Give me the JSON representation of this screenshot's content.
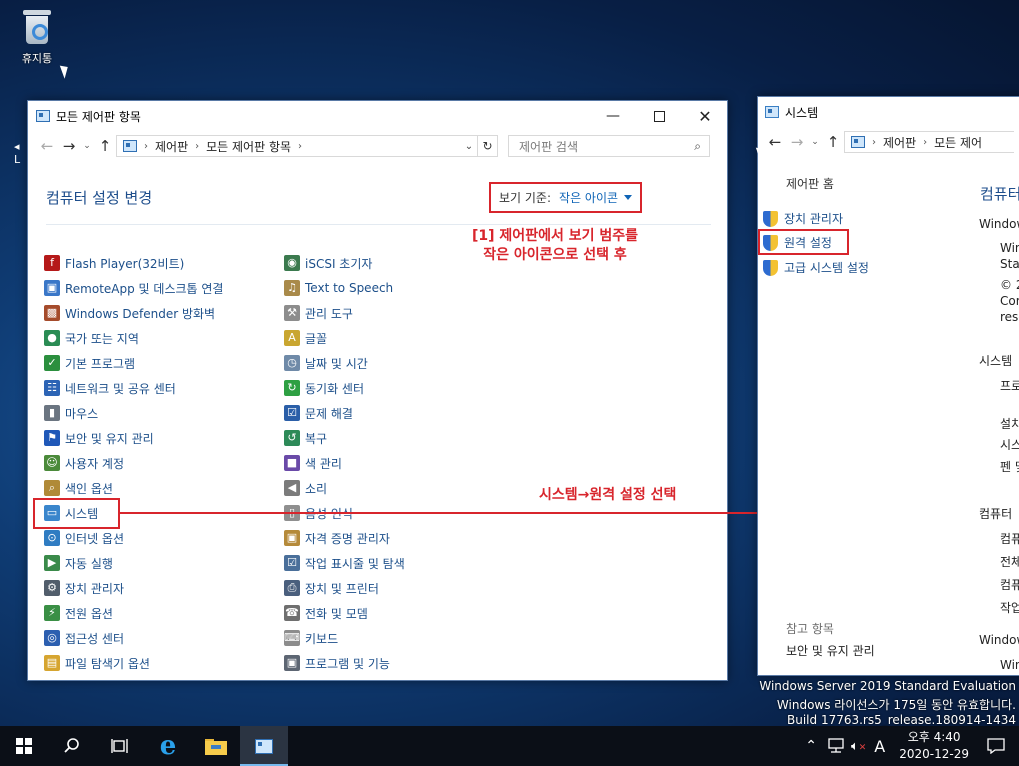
{
  "desktop": {
    "recycle_bin_label": "휴지통"
  },
  "control_panel": {
    "title": "모든 제어판 항목",
    "breadcrumb": [
      "제어판",
      "모든 제어판 항목"
    ],
    "search_placeholder": "제어판 검색",
    "heading": "컴퓨터 설정 변경",
    "view_by_label": "보기 기준:",
    "view_by_value": "작은 아이콘",
    "left_items": [
      {
        "label": "Flash Player(32비트)",
        "icon": "flash-icon"
      },
      {
        "label": "RemoteApp 및 데스크톱 연결",
        "icon": "remoteapp-icon"
      },
      {
        "label": "Windows Defender 방화벽",
        "icon": "firewall-icon"
      },
      {
        "label": "국가 또는 지역",
        "icon": "region-icon"
      },
      {
        "label": "기본 프로그램",
        "icon": "default-programs-icon"
      },
      {
        "label": "네트워크 및 공유 센터",
        "icon": "network-icon"
      },
      {
        "label": "마우스",
        "icon": "mouse-icon"
      },
      {
        "label": "보안 및 유지 관리",
        "icon": "flag-icon"
      },
      {
        "label": "사용자 계정",
        "icon": "users-icon"
      },
      {
        "label": "색인 옵션",
        "icon": "indexing-icon"
      },
      {
        "label": "시스템",
        "icon": "system-icon"
      },
      {
        "label": "인터넷 옵션",
        "icon": "internet-icon"
      },
      {
        "label": "자동 실행",
        "icon": "autoplay-icon"
      },
      {
        "label": "장치 관리자",
        "icon": "device-manager-icon"
      },
      {
        "label": "전원 옵션",
        "icon": "power-icon"
      },
      {
        "label": "접근성 센터",
        "icon": "accessibility-icon"
      },
      {
        "label": "파일 탐색기 옵션",
        "icon": "folder-options-icon"
      }
    ],
    "right_items": [
      {
        "label": "iSCSI 초기자",
        "icon": "iscsi-icon"
      },
      {
        "label": "Text to Speech",
        "icon": "speech-icon"
      },
      {
        "label": "관리 도구",
        "icon": "admin-tools-icon"
      },
      {
        "label": "글꼴",
        "icon": "fonts-icon"
      },
      {
        "label": "날짜 및 시간",
        "icon": "clock-icon"
      },
      {
        "label": "동기화 센터",
        "icon": "sync-icon"
      },
      {
        "label": "문제 해결",
        "icon": "troubleshoot-icon"
      },
      {
        "label": "복구",
        "icon": "recovery-icon"
      },
      {
        "label": "색 관리",
        "icon": "color-icon"
      },
      {
        "label": "소리",
        "icon": "sound-icon"
      },
      {
        "label": "음성 인식",
        "icon": "mic-icon"
      },
      {
        "label": "자격 증명 관리자",
        "icon": "credential-icon"
      },
      {
        "label": "작업 표시줄 및 탐색",
        "icon": "taskbar-icon"
      },
      {
        "label": "장치 및 프린터",
        "icon": "printer-icon"
      },
      {
        "label": "전화 및 모뎀",
        "icon": "phone-icon"
      },
      {
        "label": "키보드",
        "icon": "keyboard-icon"
      },
      {
        "label": "프로그램 및 기능",
        "icon": "programs-icon"
      }
    ]
  },
  "annotations": {
    "step1_line1": "[1] 제어판에서 보기 범주를",
    "step1_line2": "작은 아이콘으로 선택 후",
    "step2": "시스템→원격 설정 선택"
  },
  "system_window": {
    "title": "시스템",
    "breadcrumb": [
      "제어판",
      "모든 제어"
    ],
    "home_link": "제어판 홈",
    "links": [
      "장치 관리자",
      "원격 설정",
      "고급 시스템 설정"
    ],
    "see_also": "참고 항목",
    "see_also_link": "보안 및 유지 관리",
    "heading": "컴퓨터",
    "section_windows": "Window",
    "lines_edition": [
      "Win",
      "Star"
    ],
    "lines_copyright": [
      "© 2",
      "Cor",
      "rese"
    ],
    "section_system": "시스템",
    "sys_lines": [
      "프로",
      "설치",
      "시스",
      "펜 및"
    ],
    "section_computer": "컴퓨터",
    "comp_lines": [
      "컴퓨",
      "전체",
      "컴퓨",
      "작업"
    ],
    "section_windows2": "Window",
    "win2_line": "Win"
  },
  "watermark": {
    "line1": "Windows Server 2019 Standard Evaluation",
    "line2": "Windows 라이선스가 175일 동안 유효합니다.",
    "line3": "Build 17763.rs5_release.180914-1434"
  },
  "taskbar": {
    "time": "오후 4:40",
    "date": "2020-12-29",
    "ime": "A"
  }
}
